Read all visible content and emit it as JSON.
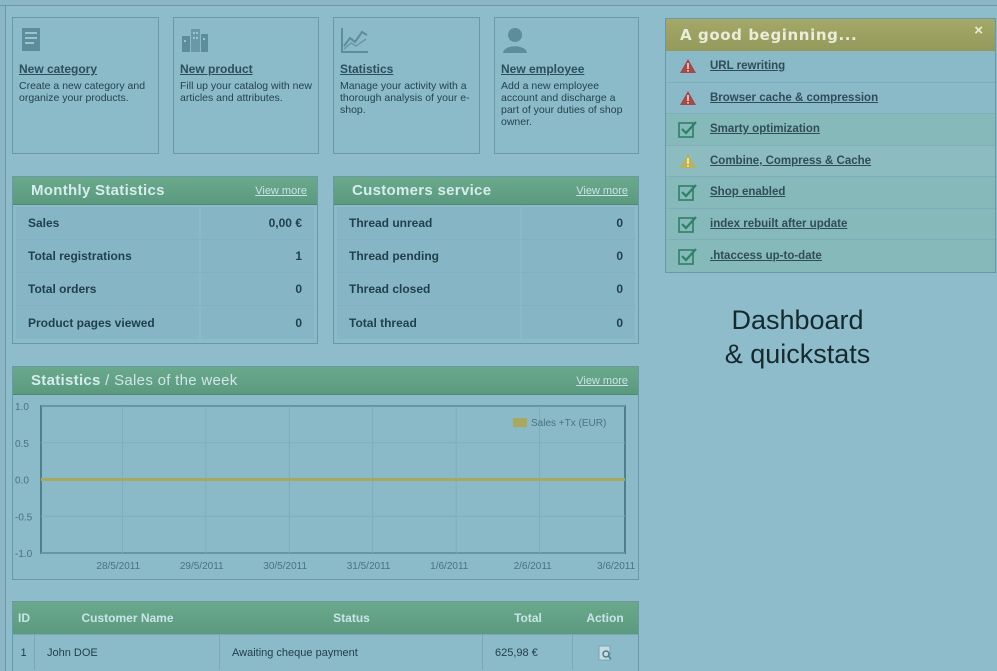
{
  "quick_actions": [
    {
      "title": "New category",
      "desc": "Create a new category and organize your products.",
      "icon": "folder-icon"
    },
    {
      "title": "New product",
      "desc": "Fill up your catalog with new articles and attributes.",
      "icon": "buildings-icon"
    },
    {
      "title": "Statistics",
      "desc": "Manage your activity with a thorough analysis of your e-shop.",
      "icon": "chart-line-icon"
    },
    {
      "title": "New employee",
      "desc": "Add a new employee account and discharge a part of your duties of shop owner.",
      "icon": "person-icon"
    }
  ],
  "monthly": {
    "title": "Monthly Statistics",
    "link": "View more",
    "rows": [
      {
        "label": "Sales",
        "value": "0,00 €"
      },
      {
        "label": "Total registrations",
        "value": "1"
      },
      {
        "label": "Total orders",
        "value": "0"
      },
      {
        "label": "Product pages viewed",
        "value": "0"
      }
    ]
  },
  "customers": {
    "title": "Customers service",
    "link": "View more",
    "rows": [
      {
        "label": "Thread unread",
        "value": "0"
      },
      {
        "label": "Thread pending",
        "value": "0"
      },
      {
        "label": "Thread closed",
        "value": "0"
      },
      {
        "label": "Total thread",
        "value": "0"
      }
    ]
  },
  "stats_panel": {
    "title": "Statistics",
    "subtitle": " / Sales of the week",
    "link": "View more"
  },
  "chart_data": {
    "type": "line",
    "categories": [
      "28/5/2011",
      "29/5/2011",
      "30/5/2011",
      "31/5/2011",
      "1/6/2011",
      "2/6/2011",
      "3/6/2011"
    ],
    "series": [
      {
        "name": "Sales +Tx (EUR)",
        "values": [
          0,
          0,
          0,
          0,
          0,
          0,
          0
        ],
        "color": "#a8a85e"
      }
    ],
    "yticks": [
      "1.0",
      "0.5",
      "0.0",
      "-0.5",
      "-1.0"
    ],
    "ylim": [
      -1,
      1
    ],
    "grid": true,
    "legend": "top-right"
  },
  "orders": {
    "headers": [
      "ID",
      "Customer Name",
      "Status",
      "Total",
      "Action"
    ],
    "rows": [
      {
        "id": "1",
        "name": "John DOE",
        "status": "Awaiting cheque payment",
        "total": "625,98 €"
      }
    ]
  },
  "checklist": {
    "title": "A good beginning...",
    "close": "×",
    "items": [
      {
        "label": "URL rewriting",
        "state": "error"
      },
      {
        "label": "Browser cache & compression",
        "state": "error"
      },
      {
        "label": "Smarty optimization",
        "state": "ok"
      },
      {
        "label": "Combine, Compress & Cache",
        "state": "warning"
      },
      {
        "label": "Shop enabled",
        "state": "ok"
      },
      {
        "label": "index rebuilt after update",
        "state": "ok"
      },
      {
        "label": ".htaccess up-to-date",
        "state": "ok"
      }
    ]
  },
  "caption": {
    "line1": "Dashboard",
    "line2": "& quickstats"
  },
  "colors": {
    "accent_green": "#5e9e80",
    "error": "#a64a4a",
    "warning": "#b8b05a",
    "ok": "#3f8a72"
  }
}
